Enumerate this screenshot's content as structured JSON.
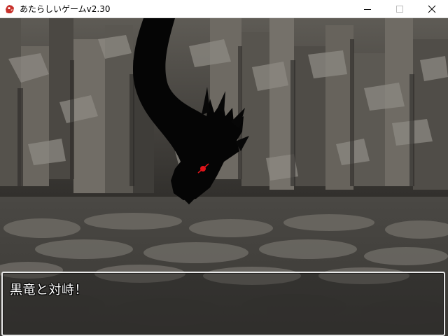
{
  "window": {
    "title": "あたらしいゲームv2.30",
    "icon": "app-icon"
  },
  "controls": {
    "minimize": "minimize-icon",
    "maximize": "maximize-icon",
    "close": "close-icon"
  },
  "scene": {
    "enemy": "black-dragon"
  },
  "message": {
    "text": "黒竜と対峙！"
  },
  "colors": {
    "eye": "#e0141a",
    "dialog_border": "#e8e8e8"
  }
}
